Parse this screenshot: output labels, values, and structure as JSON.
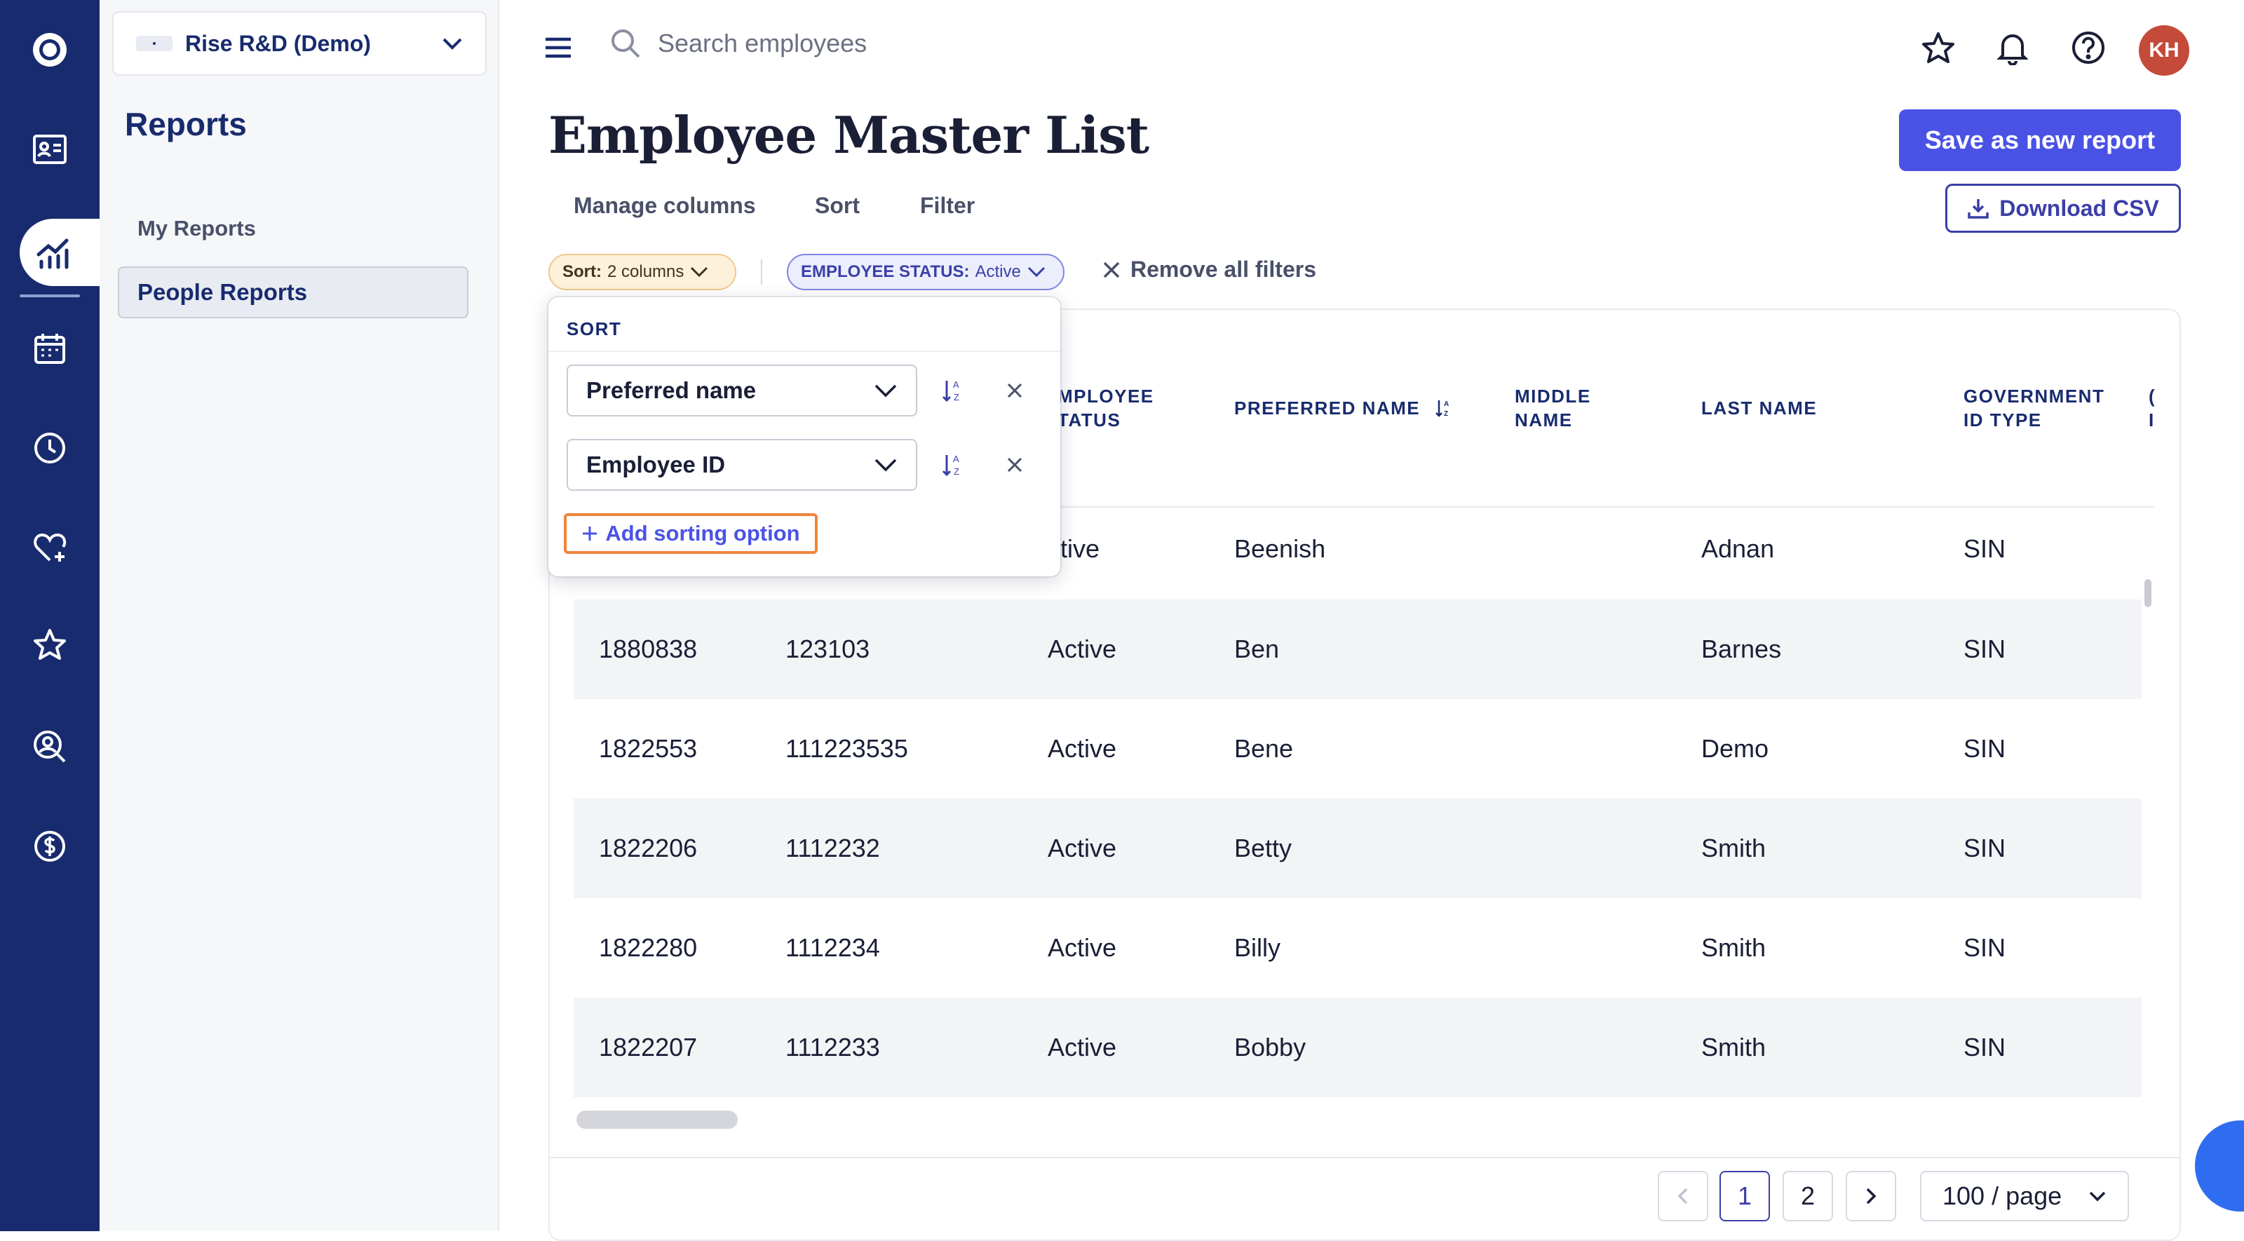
{
  "org": {
    "name": "Rise R&D (Demo)"
  },
  "sidebar": {
    "title": "Reports",
    "items": [
      {
        "label": "My Reports"
      },
      {
        "label": "People Reports"
      }
    ]
  },
  "search": {
    "placeholder": "Search employees"
  },
  "user": {
    "initials": "KH"
  },
  "page": {
    "title": "Employee Master List",
    "save_label": "Save as new report",
    "download_label": "Download CSV",
    "tabs": [
      "Manage columns",
      "Sort",
      "Filter"
    ]
  },
  "chips": {
    "sort_key": "Sort:",
    "sort_value": "2 columns",
    "status_key": "EMPLOYEE STATUS:",
    "status_value": "Active",
    "remove_all": "Remove all filters"
  },
  "sort_popover": {
    "title": "SORT",
    "options": [
      "Preferred name",
      "Employee ID"
    ],
    "add_label": "Add sorting option"
  },
  "table": {
    "headers": {
      "status_1": "MPLOYEE",
      "status_2": "TATUS",
      "preferred": "PREFERRED NAME",
      "middle_1": "MIDDLE",
      "middle_2": "NAME",
      "last": "LAST NAME",
      "gov_1": "GOVERNMENT",
      "gov_2": "ID TYPE",
      "cut_1": "(",
      "cut_2": "I"
    },
    "first_row": {
      "status": "ctive",
      "preferred": "Beenish",
      "last": "Adnan",
      "gov": "SIN"
    },
    "rows": [
      {
        "id": "1880838",
        "emp": "123103",
        "status": "Active",
        "preferred": "Ben",
        "last": "Barnes",
        "gov": "SIN"
      },
      {
        "id": "1822553",
        "emp": "111223535",
        "status": "Active",
        "preferred": "Bene",
        "last": "Demo",
        "gov": "SIN"
      },
      {
        "id": "1822206",
        "emp": "1112232",
        "status": "Active",
        "preferred": "Betty",
        "last": "Smith",
        "gov": "SIN"
      },
      {
        "id": "1822280",
        "emp": "1112234",
        "status": "Active",
        "preferred": "Billy",
        "last": "Smith",
        "gov": "SIN"
      },
      {
        "id": "1822207",
        "emp": "1112233",
        "status": "Active",
        "preferred": "Bobby",
        "last": "Smith",
        "gov": "SIN"
      }
    ]
  },
  "pagination": {
    "pages": [
      "1",
      "2"
    ],
    "current": "1",
    "page_size": "100 / page"
  }
}
